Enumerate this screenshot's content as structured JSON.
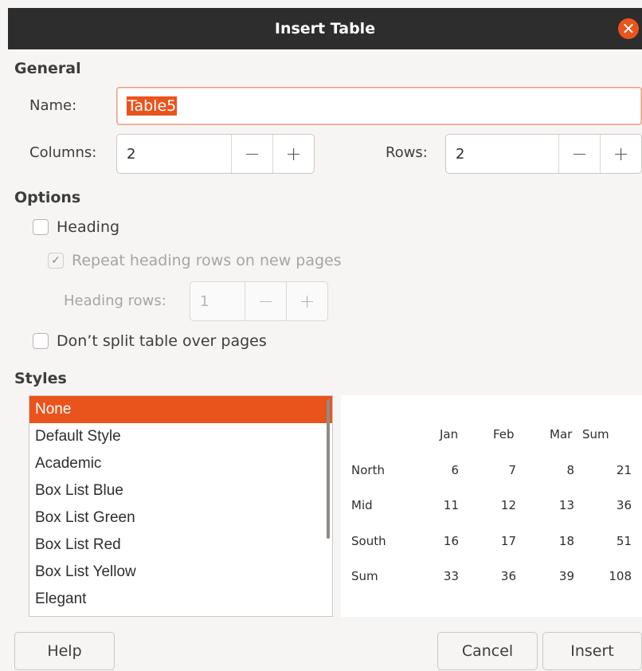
{
  "dialog": {
    "title": "Insert Table",
    "close_glyph": "✕"
  },
  "general": {
    "heading": "General",
    "name_label": "Name:",
    "name_value": "Table5",
    "columns_label": "Columns:",
    "columns_value": "2",
    "rows_label": "Rows:",
    "rows_value": "2",
    "minus": "−",
    "plus": "+"
  },
  "options": {
    "heading": "Options",
    "heading_checkbox": {
      "label": "Heading",
      "checked": false
    },
    "repeat_checkbox": {
      "label": "Repeat heading rows on new pages",
      "checked": true,
      "enabled": false
    },
    "heading_rows_label": "Heading rows:",
    "heading_rows_value": "1",
    "dont_split_checkbox": {
      "label": "Don’t split table over pages",
      "checked": false
    }
  },
  "styles": {
    "heading": "Styles",
    "items": [
      "None",
      "Default Style",
      "Academic",
      "Box List Blue",
      "Box List Green",
      "Box List Red",
      "Box List Yellow",
      "Elegant"
    ],
    "selected": "None"
  },
  "preview": {
    "headers": [
      "Jan",
      "Feb",
      "Mar",
      "Sum"
    ],
    "rows": [
      {
        "label": "North",
        "values": [
          "6",
          "7",
          "8",
          "21"
        ]
      },
      {
        "label": "Mid",
        "values": [
          "11",
          "12",
          "13",
          "36"
        ]
      },
      {
        "label": "South",
        "values": [
          "16",
          "17",
          "18",
          "51"
        ]
      },
      {
        "label": "Sum",
        "values": [
          "33",
          "36",
          "39",
          "108"
        ]
      }
    ]
  },
  "buttons": {
    "help": "Help",
    "cancel": "Cancel",
    "insert": "Insert"
  },
  "colors": {
    "accent": "#e9541d",
    "titlebar": "#2d2d2d",
    "background": "#f6f5f4"
  }
}
